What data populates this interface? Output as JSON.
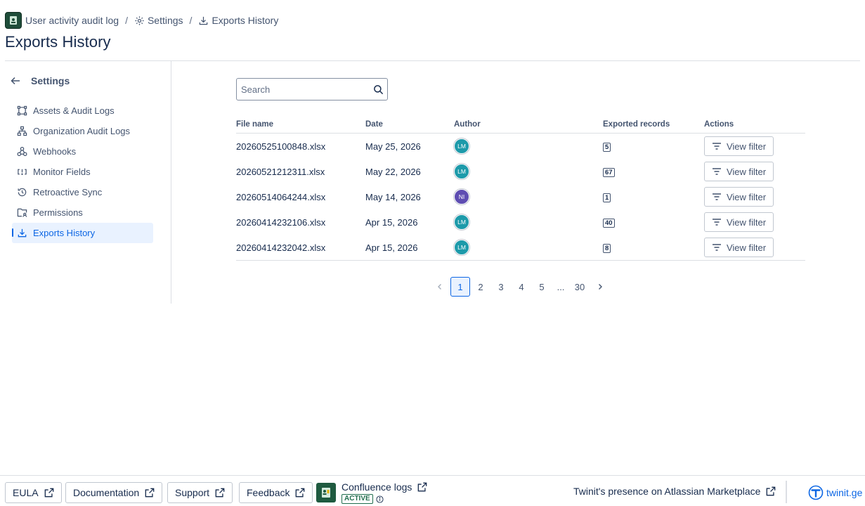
{
  "breadcrumb": {
    "app": "User activity audit log",
    "settings": "Settings",
    "current": "Exports History",
    "separator": "/"
  },
  "page_title": "Exports History",
  "sidebar": {
    "title": "Settings",
    "items": [
      {
        "label": "Assets & Audit Logs",
        "icon": "assets-icon"
      },
      {
        "label": "Organization Audit Logs",
        "icon": "org-tree-icon"
      },
      {
        "label": "Webhooks",
        "icon": "webhook-icon"
      },
      {
        "label": "Monitor Fields",
        "icon": "monitor-fields-icon"
      },
      {
        "label": "Retroactive Sync",
        "icon": "history-icon"
      },
      {
        "label": "Permissions",
        "icon": "permissions-icon"
      },
      {
        "label": "Exports History",
        "icon": "download-icon",
        "active": true
      }
    ]
  },
  "search": {
    "placeholder": "Search",
    "value": ""
  },
  "table": {
    "headers": [
      "File name",
      "Date",
      "Author",
      "Exported records",
      "Actions"
    ],
    "rows": [
      {
        "file": "20260525100848.xlsx",
        "date": "May 25, 2026",
        "author": "LM",
        "author_color": "#1d9aaa",
        "records": "5",
        "action": "View filter"
      },
      {
        "file": "20260521212311.xlsx",
        "date": "May 22, 2026",
        "author": "LM",
        "author_color": "#1d9aaa",
        "records": "67",
        "action": "View filter"
      },
      {
        "file": "20260514064244.xlsx",
        "date": "May 14, 2026",
        "author": "NI",
        "author_color": "#5e4db2",
        "records": "1",
        "action": "View filter"
      },
      {
        "file": "20260414232106.xlsx",
        "date": "Apr 15, 2026",
        "author": "LM",
        "author_color": "#1d9aaa",
        "records": "40",
        "action": "View filter"
      },
      {
        "file": "20260414232042.xlsx",
        "date": "Apr 15, 2026",
        "author": "LM",
        "author_color": "#1d9aaa",
        "records": "8",
        "action": "View filter"
      }
    ]
  },
  "pagination": {
    "pages": [
      "1",
      "2",
      "3",
      "4",
      "5"
    ],
    "ellipsis": "...",
    "last": "30",
    "current": "1"
  },
  "footer": {
    "eula": "EULA",
    "documentation": "Documentation",
    "support": "Support",
    "feedback": "Feedback",
    "confluence_logs": "Confluence logs",
    "status": "ACTIVE",
    "marketplace": "Twinit's presence on Atlassian Marketplace",
    "brand": "twinit.ge"
  },
  "colors": {
    "accent": "#0c66e4",
    "active_nav_bg": "#e9f2ff",
    "status_green": "#216e4e"
  }
}
